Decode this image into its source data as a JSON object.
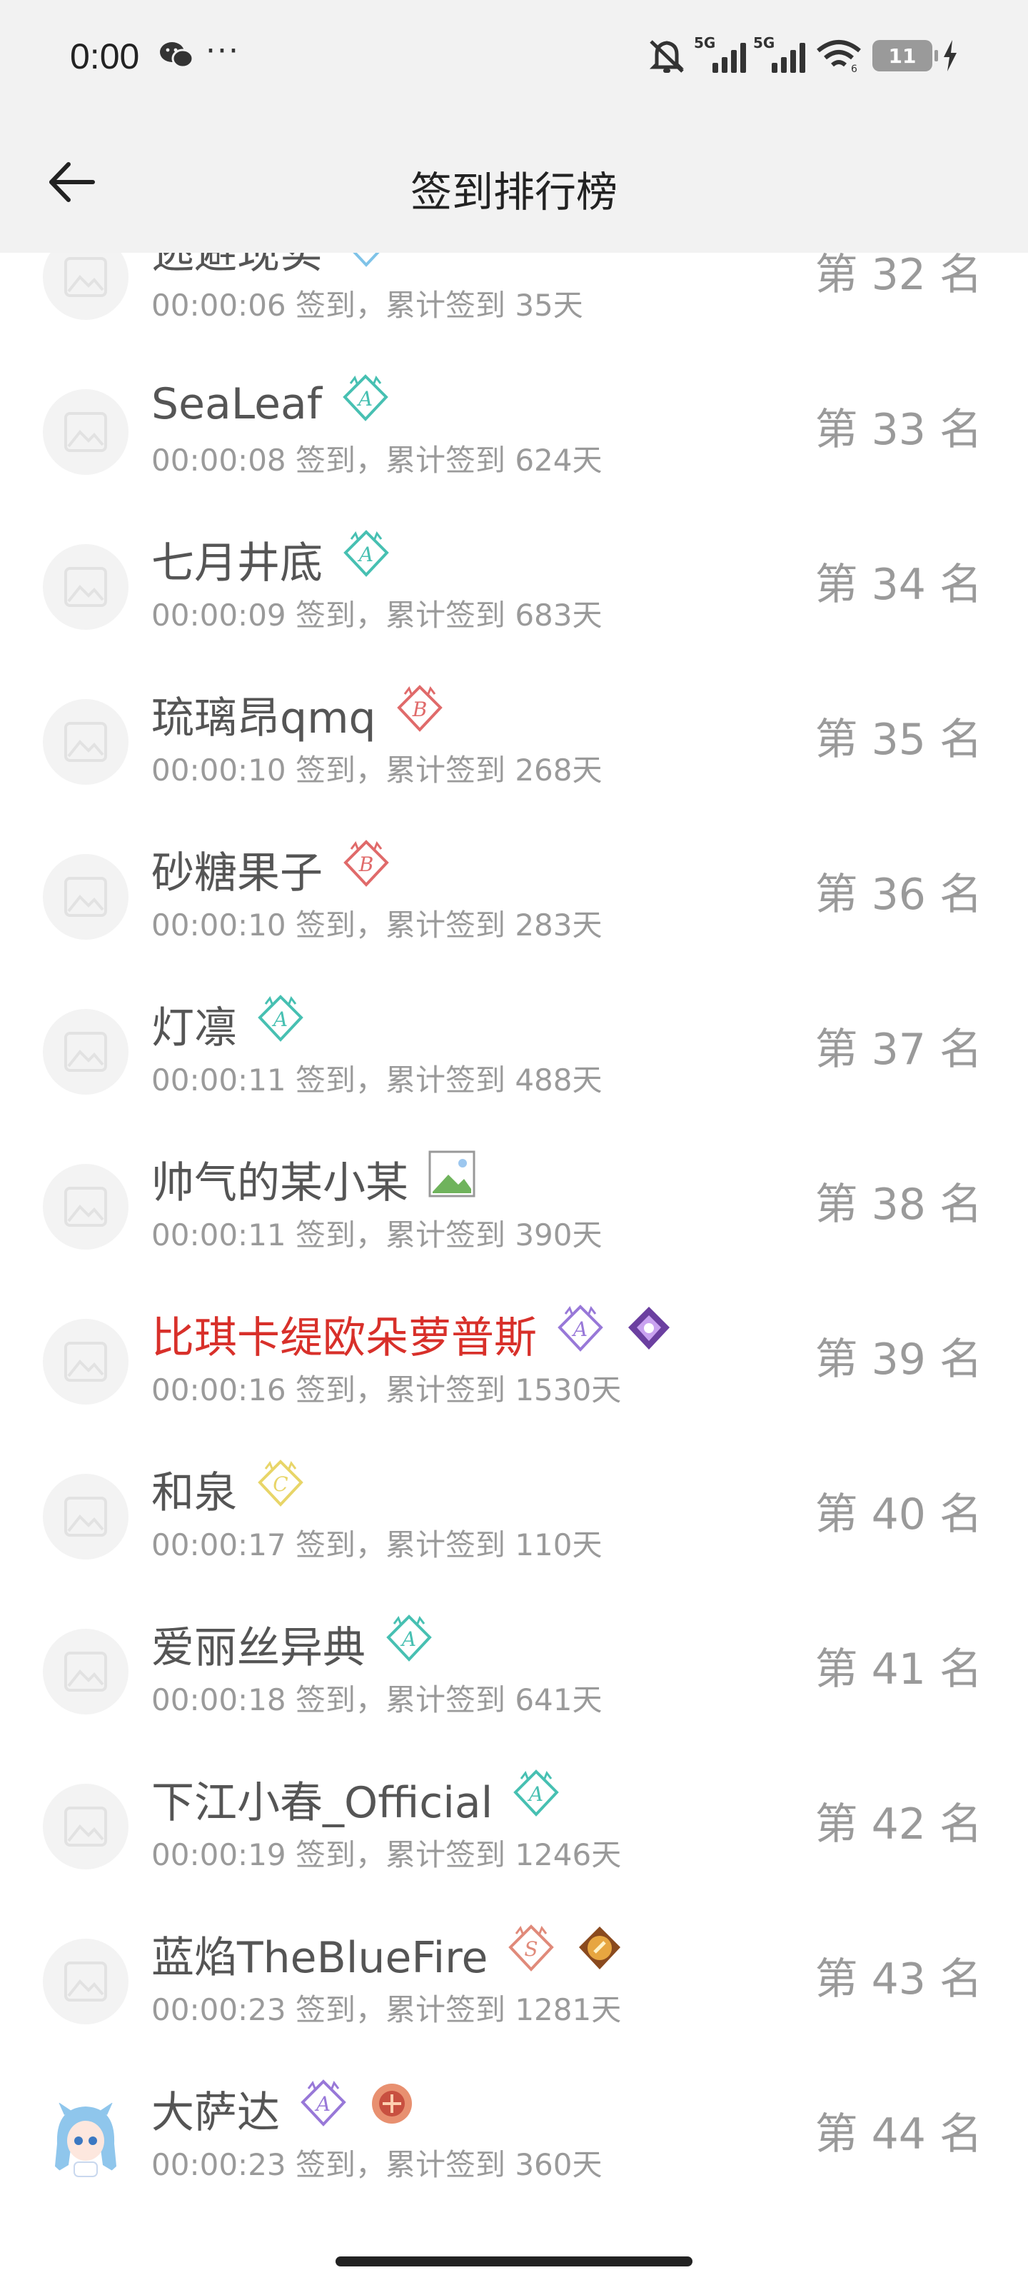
{
  "status_bar": {
    "time": "0:00",
    "more": "···",
    "network_1": "5G",
    "network_2": "5G",
    "wifi_label": "6",
    "battery": "11"
  },
  "header": {
    "title": "签到排行榜"
  },
  "colors": {
    "highlight_name": "#d8302a",
    "muted": "#9a9a9a",
    "header_bg": "#f2f2f2"
  },
  "entries": [
    {
      "name": "逃避现实",
      "highlight": false,
      "badges": [
        "badge-c-blue"
      ],
      "meta": "00:00:06 签到，累计签到 35天",
      "rank": "第 32 名"
    },
    {
      "name": "SeaLeaf",
      "highlight": false,
      "badges": [
        "badge-a-cyan"
      ],
      "meta": "00:00:08 签到，累计签到 624天",
      "rank": "第 33 名"
    },
    {
      "name": "七月井底",
      "highlight": false,
      "badges": [
        "badge-a-cyan"
      ],
      "meta": "00:00:09 签到，累计签到 683天",
      "rank": "第 34 名"
    },
    {
      "name": "琉璃昂qmq",
      "highlight": false,
      "badges": [
        "badge-b-red"
      ],
      "meta": "00:00:10 签到，累计签到 268天",
      "rank": "第 35 名"
    },
    {
      "name": "砂糖果子",
      "highlight": false,
      "badges": [
        "badge-b-red"
      ],
      "meta": "00:00:10 签到，累计签到 283天",
      "rank": "第 36 名"
    },
    {
      "name": "灯凛",
      "highlight": false,
      "badges": [
        "badge-a-cyan"
      ],
      "meta": "00:00:11 签到，累计签到 488天",
      "rank": "第 37 名"
    },
    {
      "name": "帅气的某小某",
      "highlight": false,
      "badges": [
        "broken-image"
      ],
      "meta": "00:00:11 签到，累计签到 390天",
      "rank": "第 38 名"
    },
    {
      "name": "比琪卡缇欧朵萝普斯",
      "highlight": true,
      "badges": [
        "badge-a-purple",
        "badge-gem-purple"
      ],
      "meta": "00:00:16 签到，累计签到 1530天",
      "rank": "第 39 名"
    },
    {
      "name": "和泉",
      "highlight": false,
      "badges": [
        "badge-c-yellow"
      ],
      "meta": "00:00:17 签到，累计签到 110天",
      "rank": "第 40 名"
    },
    {
      "name": "爱丽丝异典",
      "highlight": false,
      "badges": [
        "badge-a-cyan"
      ],
      "meta": "00:00:18 签到，累计签到 641天",
      "rank": "第 41 名"
    },
    {
      "name": "下江小春_Official",
      "highlight": false,
      "badges": [
        "badge-a-cyan"
      ],
      "meta": "00:00:19 签到，累计签到 1246天",
      "rank": "第 42 名"
    },
    {
      "name": "蓝焰TheBlueFire",
      "highlight": false,
      "badges": [
        "badge-s-red",
        "badge-gem-orange"
      ],
      "meta": "00:00:23 签到，累计签到 1281天",
      "rank": "第 43 名"
    },
    {
      "name": "大萨达",
      "highlight": false,
      "badges": [
        "badge-a-purple",
        "badge-crest-red"
      ],
      "meta": "00:00:23 签到，累计签到 360天",
      "rank": "第 44 名",
      "avatar": "anime"
    }
  ]
}
